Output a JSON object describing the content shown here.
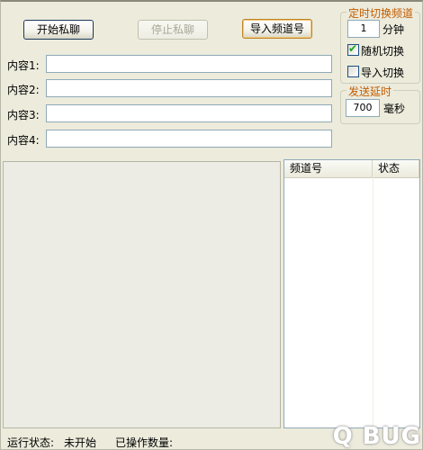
{
  "toolbar": {
    "start_label": "开始私聊",
    "stop_label": "停止私聊",
    "import_label": "导入频道号"
  },
  "content_fields": [
    {
      "label": "内容1:",
      "value": ""
    },
    {
      "label": "内容2:",
      "value": ""
    },
    {
      "label": "内容3:",
      "value": ""
    },
    {
      "label": "内容4:",
      "value": ""
    }
  ],
  "timer_group": {
    "title": "定时切换频道",
    "interval_value": "1",
    "interval_unit": "分钟",
    "random_switch_label": "随机切换",
    "random_switch_checked": true,
    "import_switch_label": "导入切换",
    "import_switch_checked": false
  },
  "delay_group": {
    "title": "发送延时",
    "value": "700",
    "unit": "毫秒"
  },
  "channel_list": {
    "columns": [
      "频道号",
      "状态"
    ],
    "rows": []
  },
  "status": {
    "run_label": "运行状态:",
    "run_value": "未开始",
    "count_label": "已操作数量:",
    "count_value": ""
  },
  "watermark": "Q BUG"
}
